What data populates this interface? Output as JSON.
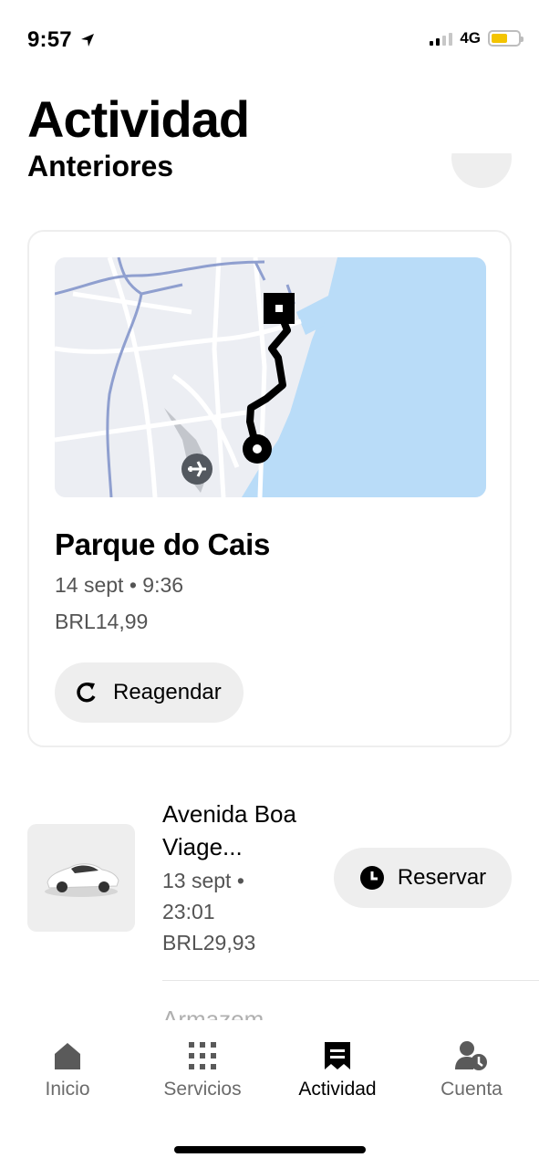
{
  "status_bar": {
    "time": "9:57",
    "network": "4G"
  },
  "header": {
    "title": "Actividad",
    "section_title": "Anteriores"
  },
  "trip_card": {
    "destination": "Parque do Cais",
    "date_time": "14 sept • 9:36",
    "price": "BRL14,99",
    "rebook_label": "Reagendar"
  },
  "trips": [
    {
      "destination": "Avenida Boa Viage...",
      "date_time": "13 sept • 23:01",
      "price": "BRL29,93",
      "action_label": "Reservar"
    }
  ],
  "next_trip_peek": "Armazem",
  "bottom_nav": [
    {
      "label": "Inicio",
      "icon": "home-icon",
      "active": false
    },
    {
      "label": "Servicios",
      "icon": "grid-icon",
      "active": false
    },
    {
      "label": "Actividad",
      "icon": "receipt-icon",
      "active": true
    },
    {
      "label": "Cuenta",
      "icon": "account-icon",
      "active": false
    }
  ],
  "colors": {
    "water": "#b9dcf8",
    "land": "#eceef3",
    "road": "#ffffff",
    "highway": "#8f9fcf",
    "button_bg": "#eeeeee",
    "battery": "#f3c400"
  }
}
